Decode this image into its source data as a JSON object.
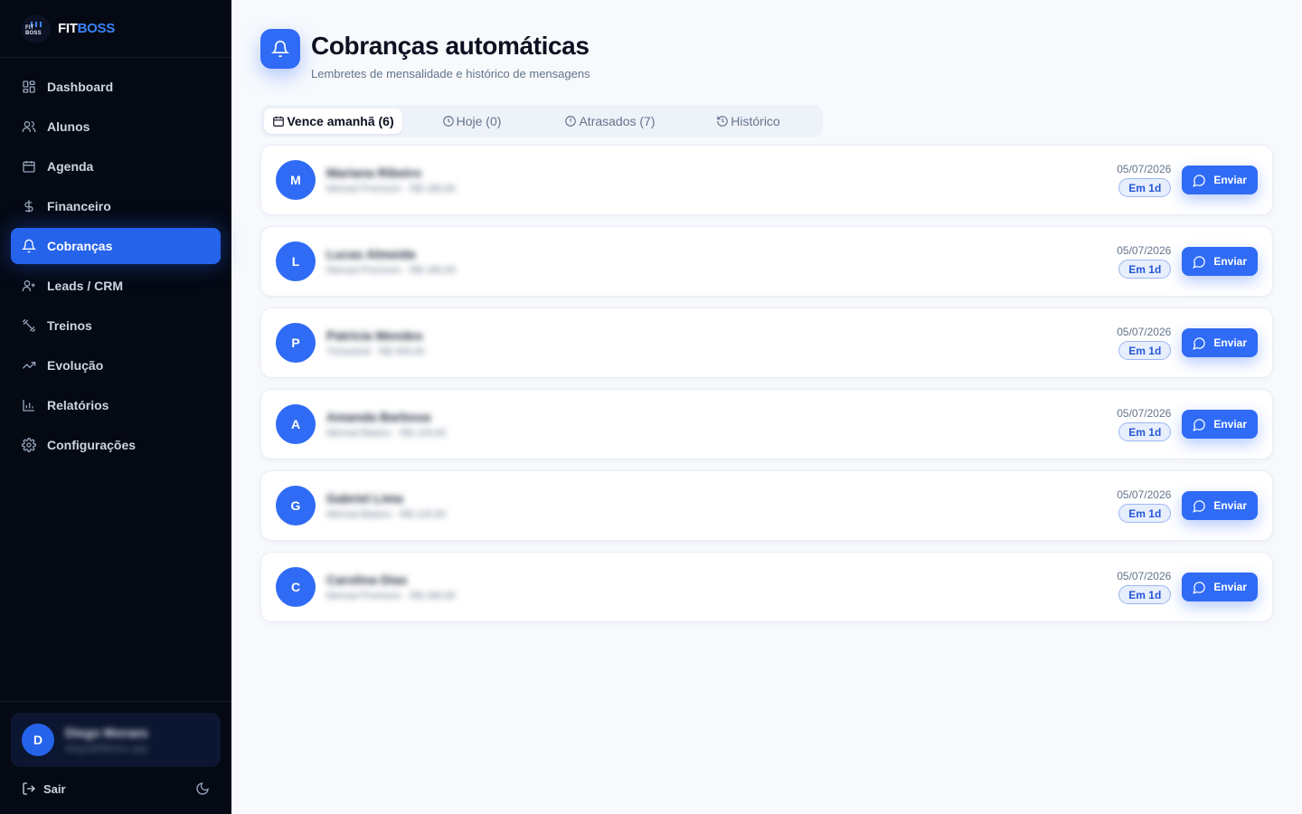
{
  "brand": {
    "fit": "FIT",
    "boss": "BOSS",
    "logo_mini": "FIT BOSS"
  },
  "sidebar": {
    "items": [
      {
        "label": "Dashboard",
        "icon": "dashboard-icon"
      },
      {
        "label": "Alunos",
        "icon": "users-icon"
      },
      {
        "label": "Agenda",
        "icon": "calendar-icon"
      },
      {
        "label": "Financeiro",
        "icon": "dollar-icon"
      },
      {
        "label": "Cobranças",
        "icon": "bell-icon",
        "active": true
      },
      {
        "label": "Leads / CRM",
        "icon": "user-plus-icon"
      },
      {
        "label": "Treinos",
        "icon": "dumbbell-icon"
      },
      {
        "label": "Evolução",
        "icon": "trending-up-icon"
      },
      {
        "label": "Relatórios",
        "icon": "bar-chart-icon"
      },
      {
        "label": "Configurações",
        "icon": "gear-icon"
      }
    ],
    "user": {
      "initial": "D",
      "name": "Diego Moraes",
      "email": "diego@fitboss.app"
    },
    "logout_label": "Sair"
  },
  "header": {
    "title": "Cobranças automáticas",
    "subtitle": "Lembretes de mensalidade e histórico de mensagens"
  },
  "tabs": [
    {
      "label": "Vence amanhã (6)",
      "icon": "calendar-icon",
      "active": true
    },
    {
      "label": "Hoje (0)",
      "icon": "clock-icon"
    },
    {
      "label": "Atrasados (7)",
      "icon": "alert-circle-icon"
    },
    {
      "label": "Histórico",
      "icon": "history-icon"
    }
  ],
  "rows": [
    {
      "initial": "M",
      "name": "Mariana Ribeiro",
      "detail": "Mensal Premium · R$ 189,90",
      "date": "05/07/2026",
      "badge": "Em 1d",
      "action": "Enviar"
    },
    {
      "initial": "L",
      "name": "Lucas Almeida",
      "detail": "Mensal Premium · R$ 189,90",
      "date": "05/07/2026",
      "badge": "Em 1d",
      "action": "Enviar"
    },
    {
      "initial": "P",
      "name": "Patricia Mendes",
      "detail": "Trimestral · R$ 499,90",
      "date": "05/07/2026",
      "badge": "Em 1d",
      "action": "Enviar"
    },
    {
      "initial": "A",
      "name": "Amanda Barbosa",
      "detail": "Mensal Básico · R$ 129,90",
      "date": "05/07/2026",
      "badge": "Em 1d",
      "action": "Enviar"
    },
    {
      "initial": "G",
      "name": "Gabriel Lima",
      "detail": "Mensal Básico · R$ 129,90",
      "date": "05/07/2026",
      "badge": "Em 1d",
      "action": "Enviar"
    },
    {
      "initial": "C",
      "name": "Carolina Dias",
      "detail": "Mensal Premium · R$ 189,90",
      "date": "05/07/2026",
      "badge": "Em 1d",
      "action": "Enviar"
    }
  ],
  "colors": {
    "accent": "#2f6bf5",
    "sidebar_bg": "#050914",
    "page_bg": "#f7f9fd"
  }
}
